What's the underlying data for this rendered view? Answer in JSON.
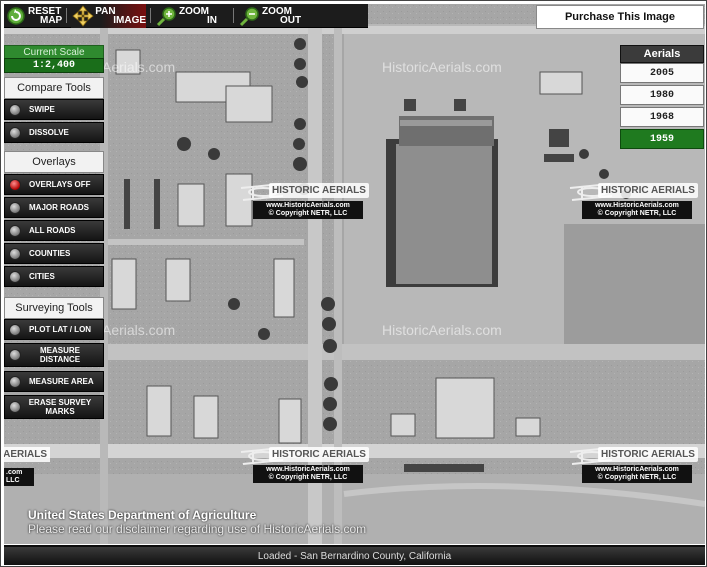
{
  "toolbar": {
    "reset": {
      "line1": "RESET",
      "line2": "MAP"
    },
    "pan": {
      "line1": "PAN",
      "line2": "IMAGE"
    },
    "zoom_in": {
      "line1": "ZOOM",
      "line2": "IN"
    },
    "zoom_out": {
      "line1": "ZOOM",
      "line2": "OUT"
    }
  },
  "purchase_label": "Purchase This Image",
  "scale": {
    "label": "Current Scale",
    "value": "1:2,400"
  },
  "compare_tools": {
    "title": "Compare Tools",
    "items": [
      "SWIPE",
      "DISSOLVE"
    ]
  },
  "overlays": {
    "title": "Overlays",
    "items": [
      "OVERLAYS OFF",
      "MAJOR ROADS",
      "ALL ROADS",
      "COUNTIES",
      "CITIES"
    ],
    "active": "OVERLAYS OFF"
  },
  "surveying": {
    "title": "Surveying Tools",
    "items": [
      {
        "line1": "PLOT LAT / LON",
        "line2": ""
      },
      {
        "line1": "MEASURE",
        "line2": "DISTANCE"
      },
      {
        "line1": "MEASURE AREA",
        "line2": ""
      },
      {
        "line1": "ERASE SURVEY",
        "line2": "MARKS"
      }
    ]
  },
  "aerials": {
    "title": "Aerials",
    "years": [
      "2005",
      "1980",
      "1968",
      "1959"
    ],
    "selected": "1959"
  },
  "watermark": {
    "site": "HistoricAerials.com",
    "site_partial": "Aerials.com",
    "banner": "HISTORIC AERIALS",
    "banner_partial": "AERIALS",
    "copy_line1": "www.HistoricAerials.com",
    "copy_line2": "© Copyright NETR, LLC",
    "copy_partial1": ".com",
    "copy_partial2": "LLC"
  },
  "footer": {
    "agency": "United States Department of Agriculture",
    "disclaimer": "Please read our disclaimer regarding use of HistoricAerials.com"
  },
  "status": "Loaded - San Bernardino County, California",
  "colors": {
    "accent_green": "#1f7a1f",
    "active_radio": "#b00000",
    "toolbar": "#1c1c1c"
  }
}
